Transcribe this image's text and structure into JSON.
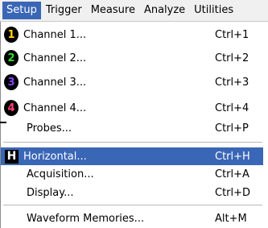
{
  "menubar": {
    "items": [
      {
        "label": "Setup",
        "active": true
      },
      {
        "label": "Trigger",
        "active": false
      },
      {
        "label": "Measure",
        "active": false
      },
      {
        "label": "Analyze",
        "active": false
      },
      {
        "label": "Utilities",
        "active": false
      }
    ]
  },
  "setup_menu": {
    "channels": [
      {
        "icon_text": "1",
        "icon_color": "#ffd800",
        "label": "Channel 1...",
        "shortcut": "Ctrl+1"
      },
      {
        "icon_text": "2",
        "icon_color": "#33dd33",
        "label": "Channel 2...",
        "shortcut": "Ctrl+2"
      },
      {
        "icon_text": "3",
        "icon_color": "#8844ff",
        "label": "Channel 3...",
        "shortcut": "Ctrl+3"
      },
      {
        "icon_text": "4",
        "icon_color": "#ff3d7a",
        "label": "Channel 4...",
        "shortcut": "Ctrl+4"
      }
    ],
    "probes": {
      "label": "Probes...",
      "shortcut": "Ctrl+P"
    },
    "horizontal": {
      "icon_text": "H",
      "label": "Horizontal...",
      "shortcut": "Ctrl+H",
      "highlighted": true
    },
    "acquisition": {
      "label": "Acquisition...",
      "shortcut": "Ctrl+A"
    },
    "display": {
      "label": "Display...",
      "shortcut": "Ctrl+D"
    },
    "waveform_memories": {
      "label": "Waveform Memories...",
      "shortcut": "Alt+M"
    }
  },
  "colors": {
    "menu_highlight": "#3a66b6",
    "menubar_background": "#f0f0f0"
  }
}
